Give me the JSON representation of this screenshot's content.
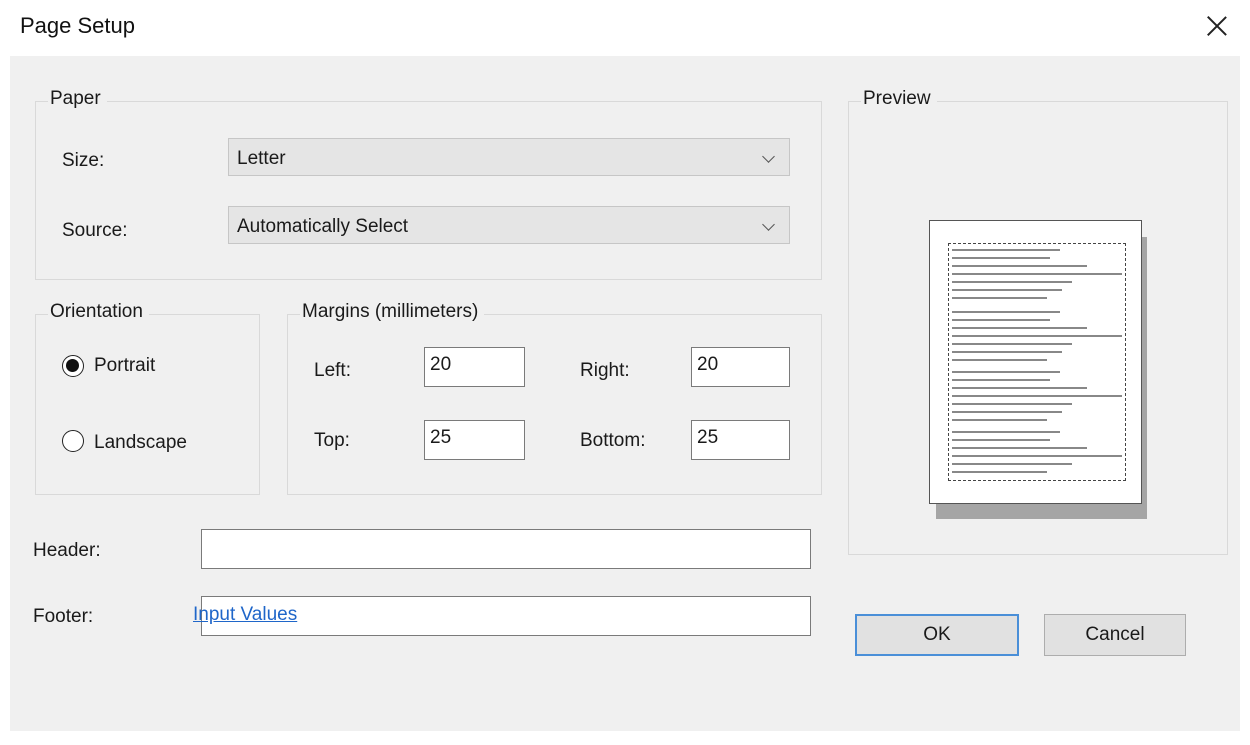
{
  "dialog": {
    "title": "Page Setup"
  },
  "paper": {
    "group_label": "Paper",
    "size_label": "Size:",
    "size_value": "Letter",
    "source_label": "Source:",
    "source_value": "Automatically Select"
  },
  "orientation": {
    "group_label": "Orientation",
    "portrait_label": "Portrait",
    "landscape_label": "Landscape",
    "selected": "Portrait"
  },
  "margins": {
    "group_label": "Margins (millimeters)",
    "left_label": "Left:",
    "left_value": "20",
    "right_label": "Right:",
    "right_value": "20",
    "top_label": "Top:",
    "top_value": "25",
    "bottom_label": "Bottom:",
    "bottom_value": "25"
  },
  "header": {
    "label": "Header:",
    "value": ""
  },
  "footer": {
    "label": "Footer:",
    "value": ""
  },
  "input_values_link": "Input Values",
  "preview": {
    "group_label": "Preview"
  },
  "buttons": {
    "ok": "OK",
    "cancel": "Cancel"
  },
  "colors": {
    "accent_border": "#4a8fd8",
    "link": "#1f66c9",
    "dialog_bg": "#f0f0f0"
  }
}
